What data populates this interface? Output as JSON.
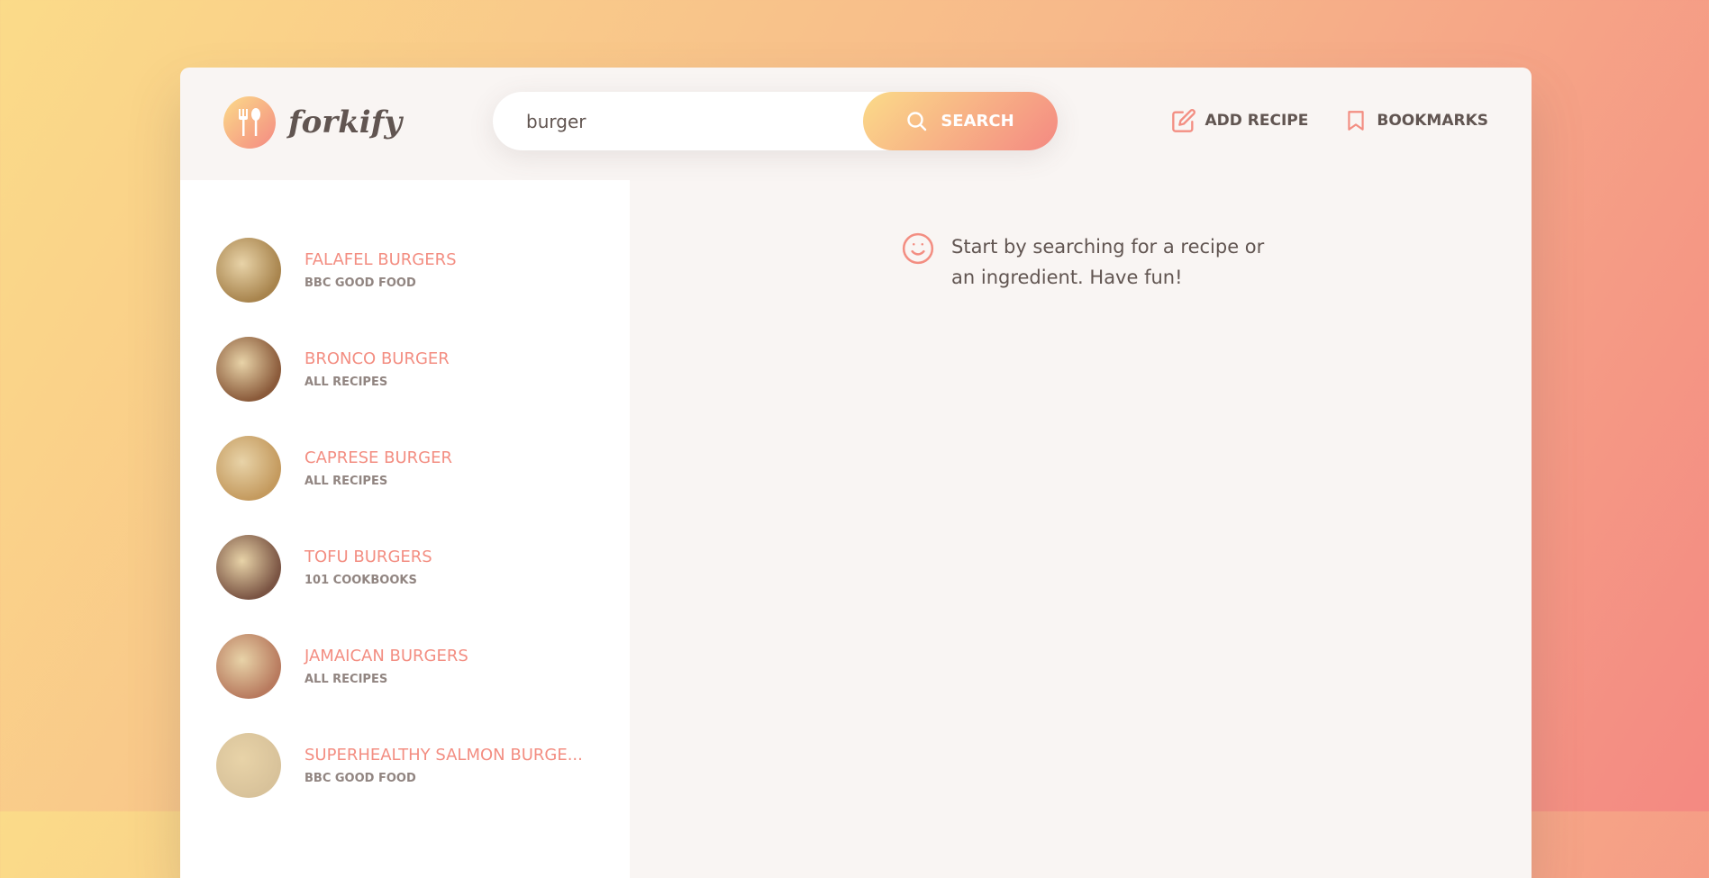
{
  "logo": {
    "text": "forkify"
  },
  "search": {
    "value": "burger",
    "button_label": "SEARCH"
  },
  "nav": {
    "add_recipe": "ADD RECIPE",
    "bookmarks": "BOOKMARKS"
  },
  "results": [
    {
      "title": "FALAFEL BURGERS",
      "publisher": "BBC GOOD FOOD",
      "color": "#a8844d"
    },
    {
      "title": "BRONCO BURGER",
      "publisher": "ALL RECIPES",
      "color": "#8a5a3a"
    },
    {
      "title": "CAPRESE BURGER",
      "publisher": "ALL RECIPES",
      "color": "#c49a5e"
    },
    {
      "title": "TOFU BURGERS",
      "publisher": "101 COOKBOOKS",
      "color": "#7a5443"
    },
    {
      "title": "JAMAICAN BURGERS",
      "publisher": "ALL RECIPES",
      "color": "#b87a5e"
    },
    {
      "title": "SUPERHEALTHY SALMON BURGE...",
      "publisher": "BBC GOOD FOOD",
      "color": "#d8c29a"
    }
  ],
  "message": {
    "text": "Start by searching for a recipe or an ingredient. Have fun!"
  }
}
